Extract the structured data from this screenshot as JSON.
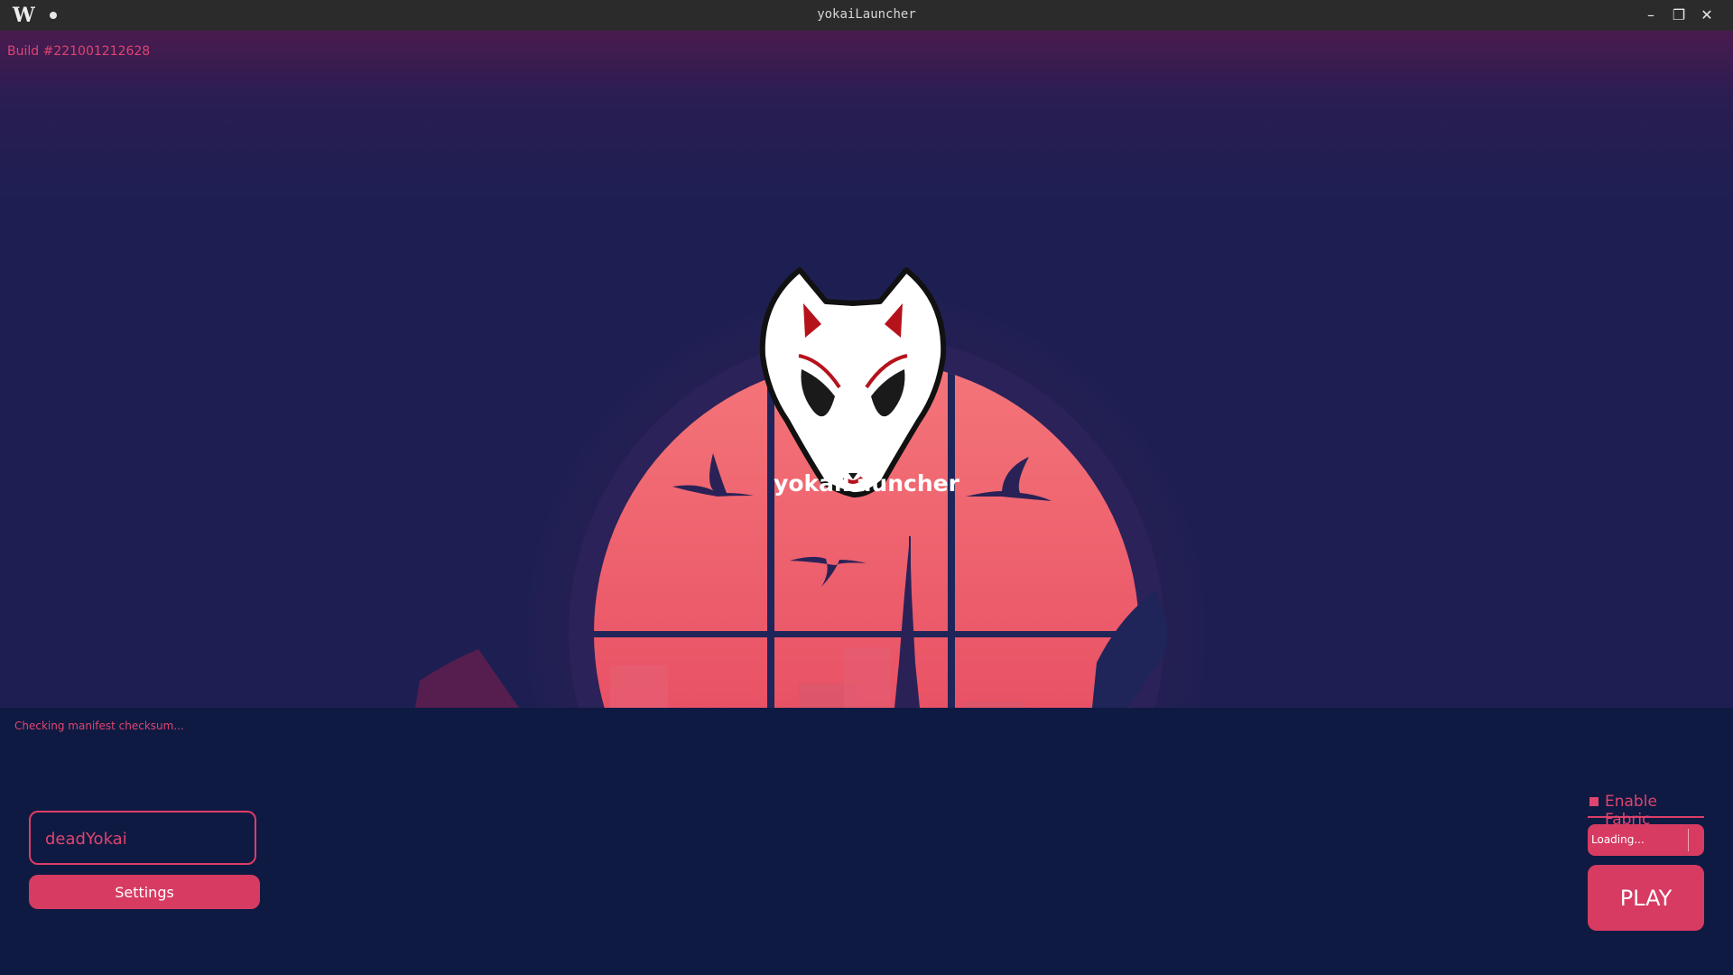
{
  "window": {
    "title": "yokaiLauncher",
    "app_logo": "W",
    "minimize": "–",
    "maximize": "❐",
    "close": "✕"
  },
  "build": "Build #221001212628",
  "brand": {
    "name": "yokaiLauncher",
    "logo_icon": "kitsune-mask-icon"
  },
  "status": "Checking manifest checksum...",
  "login": {
    "username": "deadYokai"
  },
  "settings_label": "Settings",
  "fabric": {
    "label": "Enable Fabric",
    "checked": true
  },
  "version_select": {
    "value": "Loading..."
  },
  "play_label": "PLAY",
  "colors": {
    "accent": "#d73b62",
    "background": "#0e1a42",
    "titlebar": "#2b2b2b"
  }
}
